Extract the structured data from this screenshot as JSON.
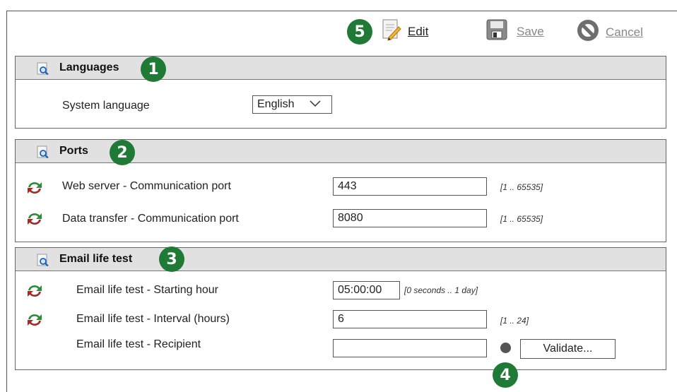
{
  "toolbar": {
    "edit_label": "Edit",
    "save_label": "Save",
    "cancel_label": "Cancel"
  },
  "badges": {
    "b1": "1",
    "b2": "2",
    "b3": "3",
    "b4": "4",
    "b5": "5"
  },
  "colors": {
    "badge": "#1e7a34",
    "header_bg": "#e1e1e1",
    "disabled_text": "#888888"
  },
  "languages": {
    "title": "Languages",
    "system_language_label": "System language",
    "system_language_value": "English"
  },
  "ports": {
    "title": "Ports",
    "web_label": "Web server - Communication port",
    "web_value": "443",
    "web_range": "[1 .. 65535]",
    "data_label": "Data transfer - Communication port",
    "data_value": "8080",
    "data_range": "[1 .. 65535]"
  },
  "email": {
    "title": "Email life test",
    "start_label": "Email life test - Starting hour",
    "start_value": "05:00:00",
    "start_range": "[0 seconds .. 1 day]",
    "interval_label": "Email life test - Interval (hours)",
    "interval_value": "6",
    "interval_range": "[1 .. 24]",
    "recipient_label": "Email life test - Recipient",
    "recipient_value": "",
    "validate_label": "Validate..."
  },
  "icons": [
    "edit-icon",
    "save-icon",
    "cancel-icon",
    "magnifier-icon",
    "refresh-icon",
    "chevron-down-icon",
    "status-dot-icon"
  ]
}
